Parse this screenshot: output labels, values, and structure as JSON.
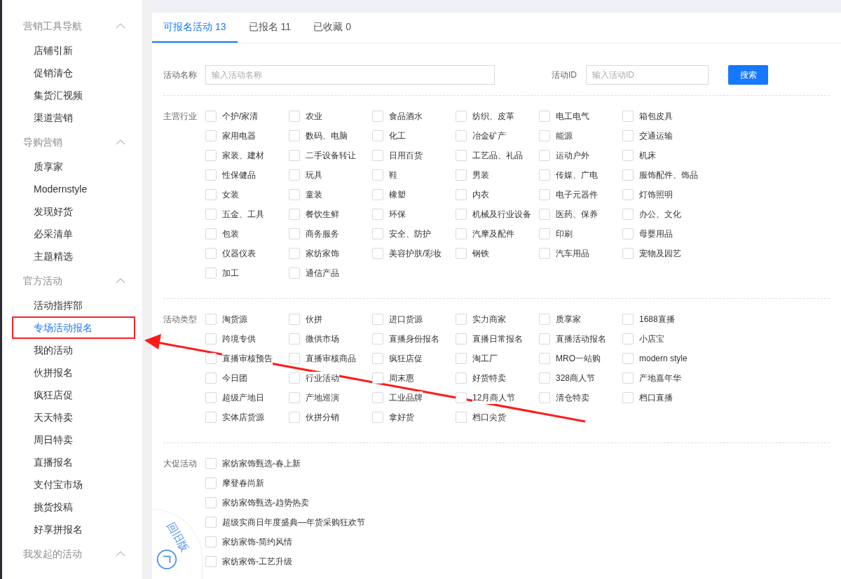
{
  "sidebar": {
    "sections": [
      {
        "title": "营销工具导航",
        "expanded": true,
        "items": [
          {
            "label": "店铺引新",
            "selected": false,
            "highlighted": false
          },
          {
            "label": "促销清仓",
            "selected": false,
            "highlighted": false
          },
          {
            "label": "集货汇视频",
            "selected": false,
            "highlighted": false
          },
          {
            "label": "渠道营销",
            "selected": false,
            "highlighted": false
          }
        ]
      },
      {
        "title": "导购营销",
        "expanded": true,
        "items": [
          {
            "label": "质享家",
            "selected": false,
            "highlighted": false
          },
          {
            "label": "Modernstyle",
            "selected": false,
            "highlighted": false
          },
          {
            "label": "发现好货",
            "selected": false,
            "highlighted": false
          },
          {
            "label": "必采清单",
            "selected": false,
            "highlighted": false
          },
          {
            "label": "主题精选",
            "selected": false,
            "highlighted": false
          }
        ]
      },
      {
        "title": "官方活动",
        "expanded": true,
        "items": [
          {
            "label": "活动指挥部",
            "selected": false,
            "highlighted": false
          },
          {
            "label": "专场活动报名",
            "selected": true,
            "highlighted": true
          },
          {
            "label": "我的活动",
            "selected": false,
            "highlighted": false
          },
          {
            "label": "伙拼报名",
            "selected": false,
            "highlighted": false
          },
          {
            "label": "疯狂店促",
            "selected": false,
            "highlighted": false
          },
          {
            "label": "天天特卖",
            "selected": false,
            "highlighted": false
          },
          {
            "label": "周日特卖",
            "selected": false,
            "highlighted": false
          },
          {
            "label": "直播报名",
            "selected": false,
            "highlighted": false
          },
          {
            "label": "支付宝市场",
            "selected": false,
            "highlighted": false
          },
          {
            "label": "挑货投稿",
            "selected": false,
            "highlighted": false
          },
          {
            "label": "好享拼报名",
            "selected": false,
            "highlighted": false
          }
        ]
      },
      {
        "title": "我发起的活动",
        "expanded": true
      }
    ]
  },
  "tabs": [
    {
      "label": "可报名活动",
      "count": "13",
      "selected": true
    },
    {
      "label": "已报名",
      "count": "11",
      "selected": false
    },
    {
      "label": "已收藏",
      "count": "0",
      "selected": false
    }
  ],
  "filters": {
    "name": {
      "label": "活动名称",
      "placeholder": "输入活动名称"
    },
    "id": {
      "label": "活动ID",
      "placeholder": "输入活动ID"
    },
    "search_button": "搜索"
  },
  "groups": [
    {
      "label": "主营行业",
      "kind": "grid",
      "options": [
        {
          "label": "个护/家清",
          "checked": false
        },
        {
          "label": "农业",
          "checked": false
        },
        {
          "label": "食品酒水",
          "checked": false
        },
        {
          "label": "纺织、皮革",
          "checked": false
        },
        {
          "label": "电工电气",
          "checked": false
        },
        {
          "label": "箱包皮具",
          "checked": false
        },
        {
          "label": "家用电器",
          "checked": false
        },
        {
          "label": "数码、电脑",
          "checked": false
        },
        {
          "label": "化工",
          "checked": false
        },
        {
          "label": "冶金矿产",
          "checked": false
        },
        {
          "label": "能源",
          "checked": false
        },
        {
          "label": "交通运输",
          "checked": false
        },
        {
          "label": "家装、建材",
          "checked": false
        },
        {
          "label": "二手设备转让",
          "checked": false
        },
        {
          "label": "日用百货",
          "checked": false
        },
        {
          "label": "工艺品、礼品",
          "checked": false
        },
        {
          "label": "运动户外",
          "checked": false
        },
        {
          "label": "机床",
          "checked": false
        },
        {
          "label": "性保健品",
          "checked": false
        },
        {
          "label": "玩具",
          "checked": false
        },
        {
          "label": "鞋",
          "checked": false
        },
        {
          "label": "男装",
          "checked": false
        },
        {
          "label": "传媒、广电",
          "checked": false
        },
        {
          "label": "服饰配件、饰品",
          "checked": false
        },
        {
          "label": "女装",
          "checked": false
        },
        {
          "label": "童装",
          "checked": false
        },
        {
          "label": "橡塑",
          "checked": false
        },
        {
          "label": "内衣",
          "checked": false
        },
        {
          "label": "电子元器件",
          "checked": false
        },
        {
          "label": "灯饰照明",
          "checked": false
        },
        {
          "label": "五金、工具",
          "checked": false
        },
        {
          "label": "餐饮生鲜",
          "checked": false
        },
        {
          "label": "环保",
          "checked": false
        },
        {
          "label": "机械及行业设备",
          "checked": false
        },
        {
          "label": "医药、保养",
          "checked": false
        },
        {
          "label": "办公、文化",
          "checked": false
        },
        {
          "label": "包装",
          "checked": false
        },
        {
          "label": "商务服务",
          "checked": false
        },
        {
          "label": "安全、防护",
          "checked": false
        },
        {
          "label": "汽摩及配件",
          "checked": false
        },
        {
          "label": "印刷",
          "checked": false
        },
        {
          "label": "母婴用品",
          "checked": false
        },
        {
          "label": "仪器仪表",
          "checked": false
        },
        {
          "label": "家纺家饰",
          "checked": false
        },
        {
          "label": "美容护肤/彩妆",
          "checked": false
        },
        {
          "label": "钢铁",
          "checked": false
        },
        {
          "label": "汽车用品",
          "checked": false
        },
        {
          "label": "宠物及园艺",
          "checked": false
        },
        {
          "label": "加工",
          "checked": false
        },
        {
          "label": "通信产品",
          "checked": false
        }
      ]
    },
    {
      "label": "活动类型",
      "kind": "grid",
      "options": [
        {
          "label": "淘货源",
          "checked": false
        },
        {
          "label": "伙拼",
          "checked": false
        },
        {
          "label": "进口货源",
          "checked": false
        },
        {
          "label": "实力商家",
          "checked": false
        },
        {
          "label": "质享家",
          "checked": false
        },
        {
          "label": "1688直播",
          "checked": false
        },
        {
          "label": "跨境专供",
          "checked": false
        },
        {
          "label": "微供市场",
          "checked": false
        },
        {
          "label": "直播身份报名",
          "checked": false
        },
        {
          "label": "直播日常报名",
          "checked": false
        },
        {
          "label": "直播活动报名",
          "checked": false
        },
        {
          "label": "小店宝",
          "checked": false
        },
        {
          "label": "直播审核预告",
          "checked": false
        },
        {
          "label": "直播审核商品",
          "checked": false
        },
        {
          "label": "疯狂店促",
          "checked": false
        },
        {
          "label": "淘工厂",
          "checked": false
        },
        {
          "label": "MRO一站购",
          "checked": false
        },
        {
          "label": "modern style",
          "checked": false
        },
        {
          "label": "今日团",
          "checked": false
        },
        {
          "label": "行业活动",
          "checked": false
        },
        {
          "label": "周末惠",
          "checked": false
        },
        {
          "label": "好货特卖",
          "checked": false
        },
        {
          "label": "328商人节",
          "checked": false
        },
        {
          "label": "产地嘉年华",
          "checked": false
        },
        {
          "label": "超级产地日",
          "checked": false
        },
        {
          "label": "产地巡演",
          "checked": false
        },
        {
          "label": "工业品牌",
          "checked": false
        },
        {
          "label": "12月商人节",
          "checked": false
        },
        {
          "label": "清仓特卖",
          "checked": false
        },
        {
          "label": "档口直播",
          "checked": false
        },
        {
          "label": "实体店货源",
          "checked": false
        },
        {
          "label": "伙拼分销",
          "checked": false
        },
        {
          "label": "拿好货",
          "checked": false
        },
        {
          "label": "档口尖货",
          "checked": false
        }
      ]
    },
    {
      "label": "大促活动",
      "kind": "list",
      "options": [
        {
          "label": "家纺家饰甄选-春上新",
          "checked": false
        },
        {
          "label": "摩登春尚新",
          "checked": false
        },
        {
          "label": "家纺家饰甄选-趋势热卖",
          "checked": false
        },
        {
          "label": "超级实商日年度盛典—年货采购狂欢节",
          "checked": false
        },
        {
          "label": "家纺家饰-简约风情",
          "checked": false
        },
        {
          "label": "家纺家饰-工艺升级",
          "checked": false
        }
      ]
    }
  ],
  "old_version_badge": {
    "label": "回旧版"
  }
}
